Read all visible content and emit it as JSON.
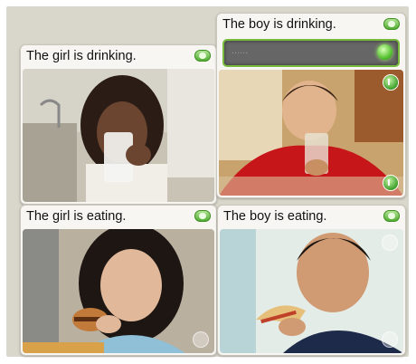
{
  "cards": [
    {
      "caption": "The girl is drinking."
    },
    {
      "caption": "The boy is drinking."
    },
    {
      "caption": "The girl is eating."
    },
    {
      "caption": "The boy is eating."
    }
  ],
  "answer_field": {
    "value": "......"
  },
  "colors": {
    "accent": "#78bb3c",
    "background": "#d9d7cb",
    "card": "#f7f6f2"
  }
}
